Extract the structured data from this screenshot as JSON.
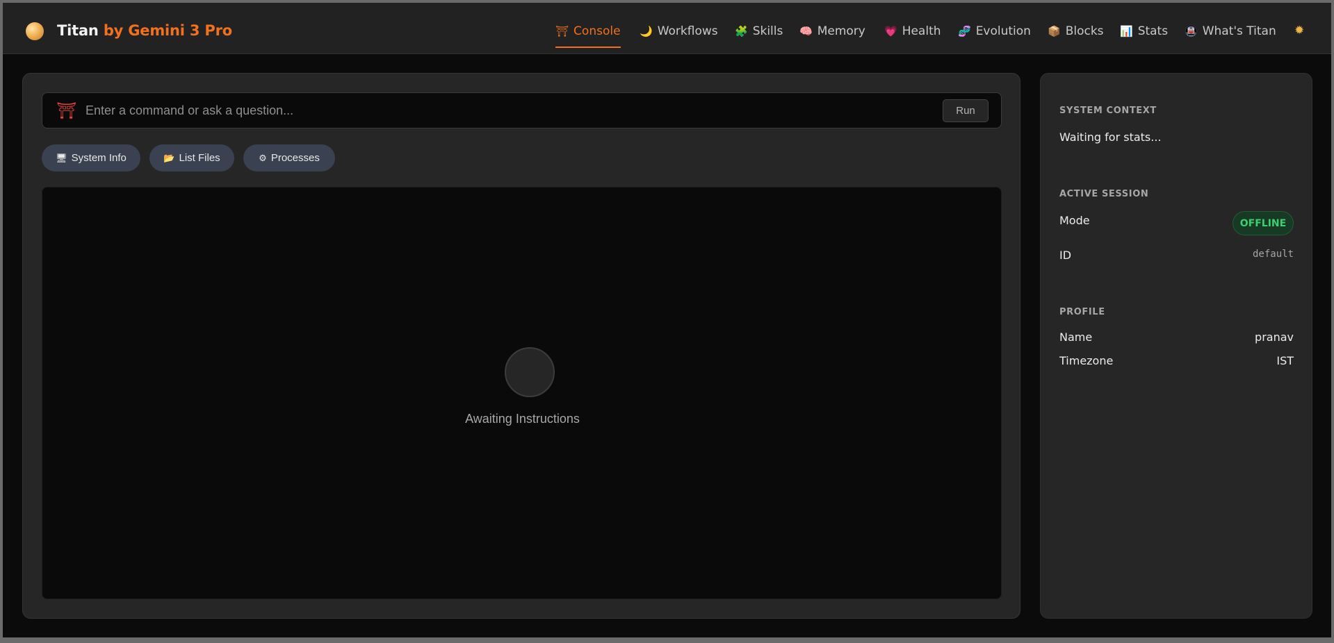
{
  "header": {
    "brand_name": "Titan",
    "brand_suffix": "by Gemini 3 Pro",
    "theme_icon": "sun-icon"
  },
  "nav": [
    {
      "icon": "⛩",
      "label": "Console",
      "active": true
    },
    {
      "icon": "🌙",
      "label": "Workflows"
    },
    {
      "icon": "🧩",
      "label": "Skills"
    },
    {
      "icon": "🧠",
      "label": "Memory"
    },
    {
      "icon": "💗",
      "label": "Health"
    },
    {
      "icon": "🧬",
      "label": "Evolution"
    },
    {
      "icon": "📦",
      "label": "Blocks"
    },
    {
      "icon": "📊",
      "label": "Stats"
    },
    {
      "icon": "🚇",
      "label": "What's Titan"
    }
  ],
  "console": {
    "icon": "⛩",
    "placeholder": "Enter a command or ask a question...",
    "value": "",
    "run_label": "Run",
    "quick_actions": [
      {
        "icon": "🖥",
        "label": "System Info"
      },
      {
        "icon": "📂",
        "label": "List Files"
      },
      {
        "icon": "⚙",
        "label": "Processes"
      }
    ],
    "status_text": "Awaiting Instructions"
  },
  "sidebar": {
    "system_context": {
      "title": "SYSTEM CONTEXT",
      "text": "Waiting for stats..."
    },
    "active_session": {
      "title": "ACTIVE SESSION",
      "mode_label": "Mode",
      "mode_value": "OFFLINE",
      "id_label": "ID",
      "id_value": "default"
    },
    "profile": {
      "title": "PROFILE",
      "name_label": "Name",
      "name_value": "pranav",
      "timezone_label": "Timezone",
      "timezone_value": "IST"
    }
  },
  "colors": {
    "accent": "#f0711f",
    "offline": "#3fcf71",
    "torii": "#e2403a"
  }
}
